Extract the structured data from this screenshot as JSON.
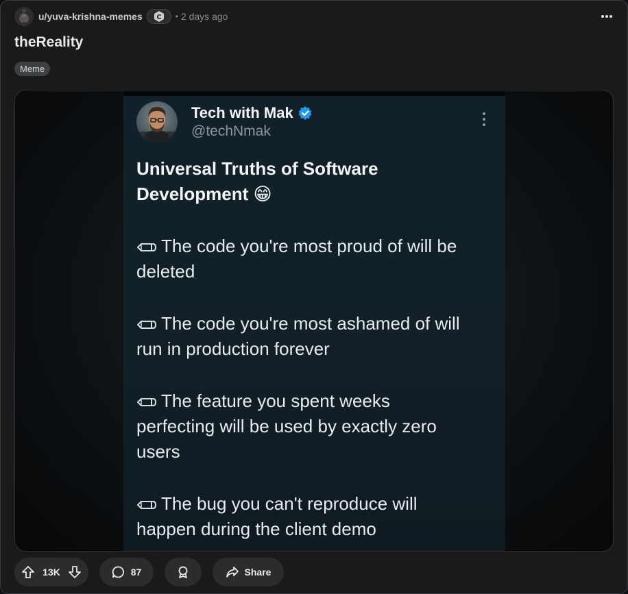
{
  "post": {
    "author": "u/yuva-krishna-memes",
    "separator": "•",
    "time": "2 days ago",
    "title": "theReality",
    "flair": "Meme"
  },
  "tweet": {
    "name": "Tech with Mak",
    "handle": "@techNmak",
    "heading_line1": "Universal Truths of Software",
    "heading_line2": "Development 😁",
    "points": [
      "The code you're most proud of will be deleted",
      "The code you're most ashamed of will run in production forever",
      "The feature you spent weeks perfecting will be used by exactly zero users",
      "The bug you can't reproduce will happen during the client demo"
    ],
    "point_lines": [
      [
        "The code you're most proud of will be",
        "deleted"
      ],
      [
        "The code you're most ashamed of will",
        "run in production forever"
      ],
      [
        "The feature you spent weeks",
        "perfecting will be used by exactly zero",
        "users"
      ],
      [
        "The bug you can't reproduce will",
        "happen during the client demo"
      ]
    ]
  },
  "actions": {
    "upvotes": "13K",
    "comments": "87",
    "share_label": "Share"
  },
  "icons": {
    "upvote": "arrow-up-icon",
    "downvote": "arrow-down-icon",
    "comment": "comment-icon",
    "award": "award-icon",
    "share": "share-icon",
    "more": "more-icon",
    "verified": "verified-icon",
    "pencil": "pencil-icon"
  },
  "colors": {
    "background": "#1a1a1b",
    "verified": "#1d9bf0",
    "pill": "#2a2c2e"
  }
}
